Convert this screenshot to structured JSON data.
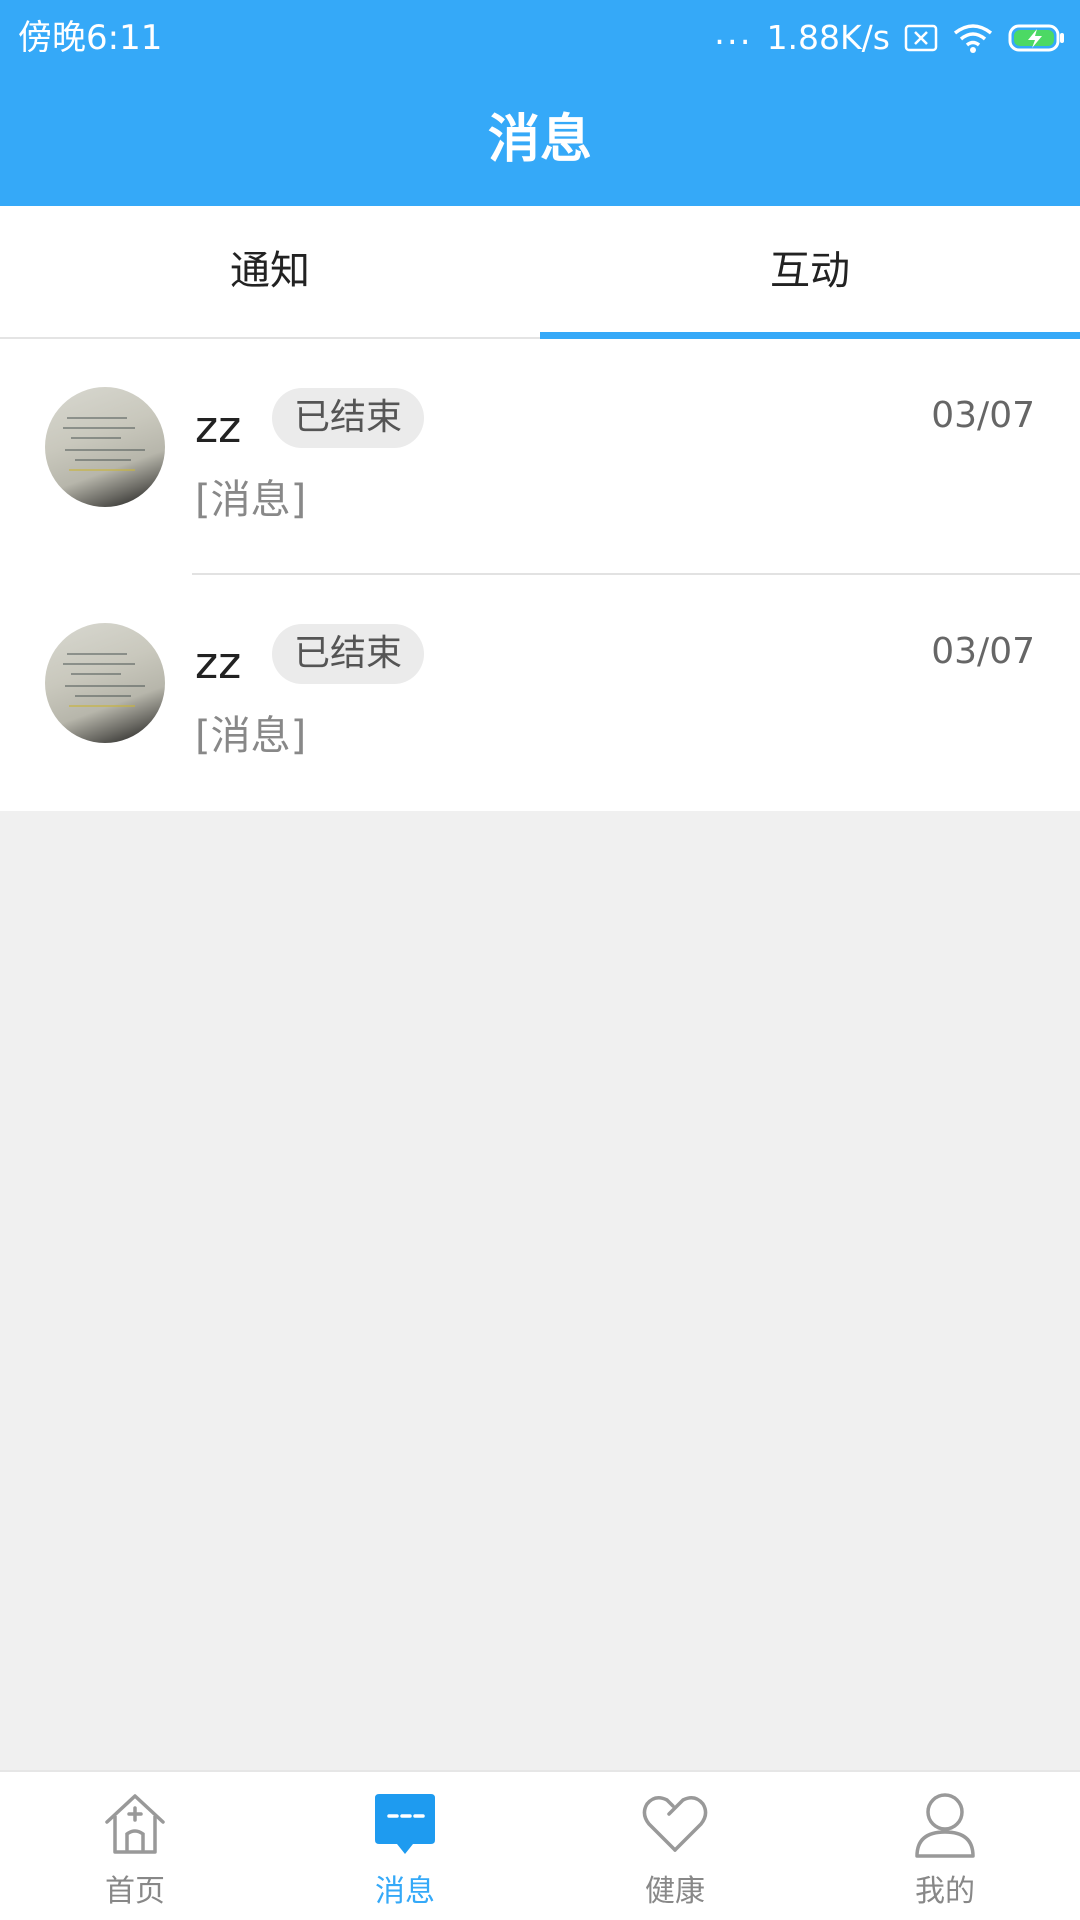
{
  "status_bar": {
    "time": "傍晚6:11",
    "dots": "...",
    "speed": "1.88K/s"
  },
  "header": {
    "title": "消息"
  },
  "tabs": [
    {
      "label": "通知",
      "active": false
    },
    {
      "label": "互动",
      "active": true
    }
  ],
  "messages": [
    {
      "name": "zz",
      "status": "已结束",
      "date": "03/07",
      "preview": "[消息]"
    },
    {
      "name": "zz",
      "status": "已结束",
      "date": "03/07",
      "preview": "[消息]"
    }
  ],
  "bottom_nav": [
    {
      "label": "首页",
      "icon": "home-icon",
      "active": false
    },
    {
      "label": "消息",
      "icon": "message-icon",
      "active": true
    },
    {
      "label": "健康",
      "icon": "heart-icon",
      "active": false
    },
    {
      "label": "我的",
      "icon": "person-icon",
      "active": false
    }
  ],
  "colors": {
    "accent": "#35a9f8",
    "inactive": "#888888",
    "background": "#f0f0f0"
  }
}
